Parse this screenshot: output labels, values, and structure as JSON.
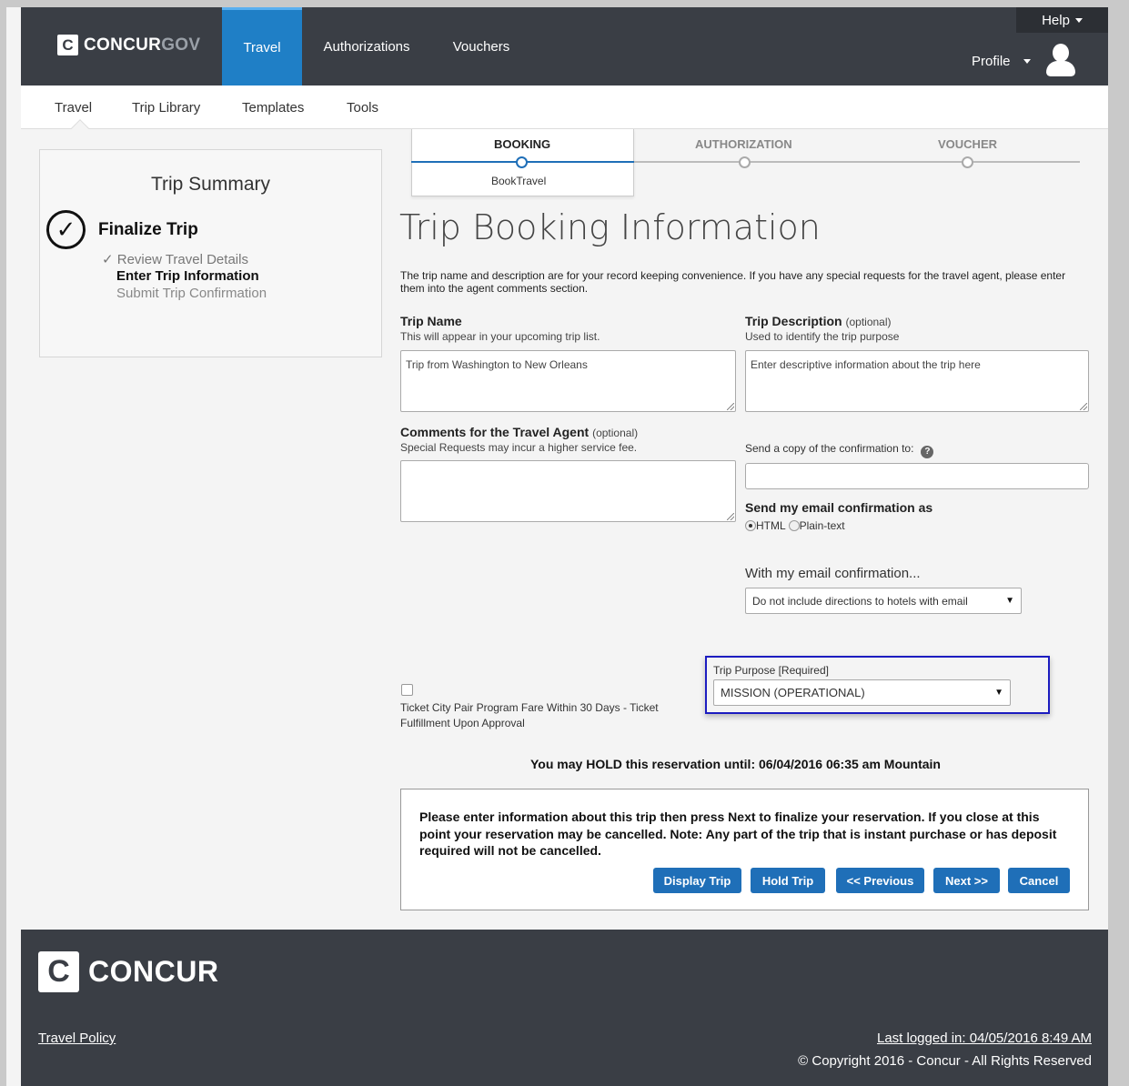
{
  "brand": {
    "logo_letter": "C",
    "logo_main": "CONCUR",
    "logo_suffix": "GOV"
  },
  "topnav": {
    "travel": "Travel",
    "authorizations": "Authorizations",
    "vouchers": "Vouchers",
    "help": "Help",
    "profile": "Profile"
  },
  "subnav": {
    "travel": "Travel",
    "trip_library": "Trip Library",
    "templates": "Templates",
    "tools": "Tools"
  },
  "summary": {
    "title": "Trip Summary",
    "current": "Finalize Trip",
    "steps": [
      "✓ Review Travel Details",
      "Enter Trip Information",
      "Submit Trip Confirmation"
    ]
  },
  "tracker": {
    "booking": "BOOKING",
    "authorization": "AUTHORIZATION",
    "voucher": "VOUCHER",
    "sub": "BookTravel"
  },
  "main": {
    "title": "Trip Booking Information",
    "intro": "The trip name and description are for your record keeping convenience. If you have any special requests for the travel agent, please enter them into the agent comments section.",
    "trip_name_label": "Trip Name",
    "trip_name_hint": "This will appear in your upcoming trip list.",
    "trip_name_value": "Trip from Washington to New Orleans",
    "trip_desc_label": "Trip Description",
    "trip_desc_optional": "(optional)",
    "trip_desc_hint": "Used to identify the trip purpose",
    "trip_desc_placeholder": "Enter descriptive information about the trip here",
    "comments_label": "Comments for the Travel Agent",
    "comments_optional": "(optional)",
    "comments_hint": "Special Requests may incur a higher service fee.",
    "copy_label": "Send a copy of the confirmation to:",
    "email_format_label": "Send my email confirmation as",
    "format_html": "HTML",
    "format_plain": "Plain-text",
    "with_email_label": "With my email confirmation...",
    "directions_value": "Do not include directions to hotels with email",
    "ticket_text": "Ticket City Pair Program Fare Within 30 Days - Ticket Fulfillment Upon Approval",
    "purpose_label": "Trip Purpose [Required]",
    "purpose_value": "MISSION (OPERATIONAL)",
    "hold_text": "You may HOLD this reservation until: 06/04/2016 06:35 am Mountain",
    "notice": "Please enter information about this trip then press Next to finalize your reservation. If you close at this point your reservation may be cancelled. Note: Any part of the trip that is instant purchase or has deposit required will not be cancelled."
  },
  "buttons": {
    "display": "Display Trip",
    "hold": "Hold Trip",
    "previous": "<< Previous",
    "next": "Next >>",
    "cancel": "Cancel"
  },
  "footer": {
    "logo_letter": "C",
    "logo_text": "CONCUR",
    "policy": "Travel Policy",
    "last_logged": "Last logged in: 04/05/2016 8:49 AM",
    "copyright": "© Copyright 2016 - Concur - All Rights Reserved"
  },
  "colors": {
    "topbar": "#3a3e45",
    "accent": "#1f7fc6",
    "button": "#1f6fb8",
    "tracker_active": "#1f6fb8",
    "highlight": "#1c1cc0"
  },
  "icons": {
    "check": "checkmark-circle-icon",
    "help": "question-circle-icon",
    "user": "user-avatar-icon"
  }
}
